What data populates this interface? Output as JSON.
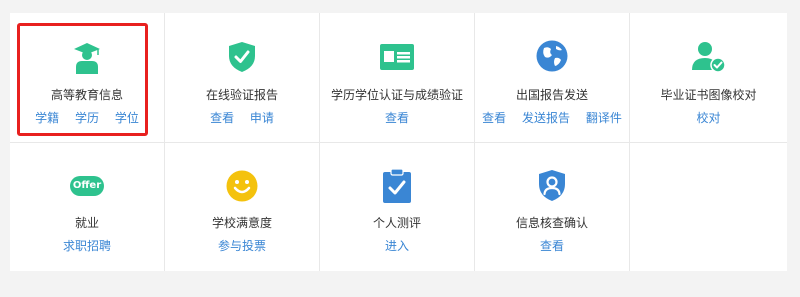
{
  "colors": {
    "accent_green": "#2ec28e",
    "accent_blue": "#3a86d4",
    "highlight_red": "#e8201f",
    "smile_yellow": "#f4c20d"
  },
  "services": [
    {
      "id": "higher-edu-info",
      "title": "高等教育信息",
      "icon": "graduate-icon",
      "links": [
        "学籍",
        "学历",
        "学位"
      ],
      "highlighted": true
    },
    {
      "id": "online-report",
      "title": "在线验证报告",
      "icon": "shield-check-icon",
      "links": [
        "查看",
        "申请"
      ]
    },
    {
      "id": "degree-cert",
      "title": "学历学位认证与成绩验证",
      "icon": "id-card-icon",
      "links": [
        "查看"
      ]
    },
    {
      "id": "abroad-report",
      "title": "出国报告发送",
      "icon": "globe-icon",
      "links": [
        "查看",
        "发送报告",
        "翻译件"
      ]
    },
    {
      "id": "photo-check",
      "title": "毕业证书图像校对",
      "icon": "user-check-icon",
      "links": [
        "校对"
      ]
    },
    {
      "id": "employment",
      "title": "就业",
      "icon": "offer-icon",
      "icon_text": "Offer",
      "links": [
        "求职招聘"
      ]
    },
    {
      "id": "satisfaction",
      "title": "学校满意度",
      "icon": "smiley-icon",
      "links": [
        "参与投票"
      ]
    },
    {
      "id": "assessment",
      "title": "个人测评",
      "icon": "clipboard-check-icon",
      "links": [
        "进入"
      ]
    },
    {
      "id": "info-confirm",
      "title": "信息核查确认",
      "icon": "user-shield-icon",
      "links": [
        "查看"
      ]
    }
  ]
}
